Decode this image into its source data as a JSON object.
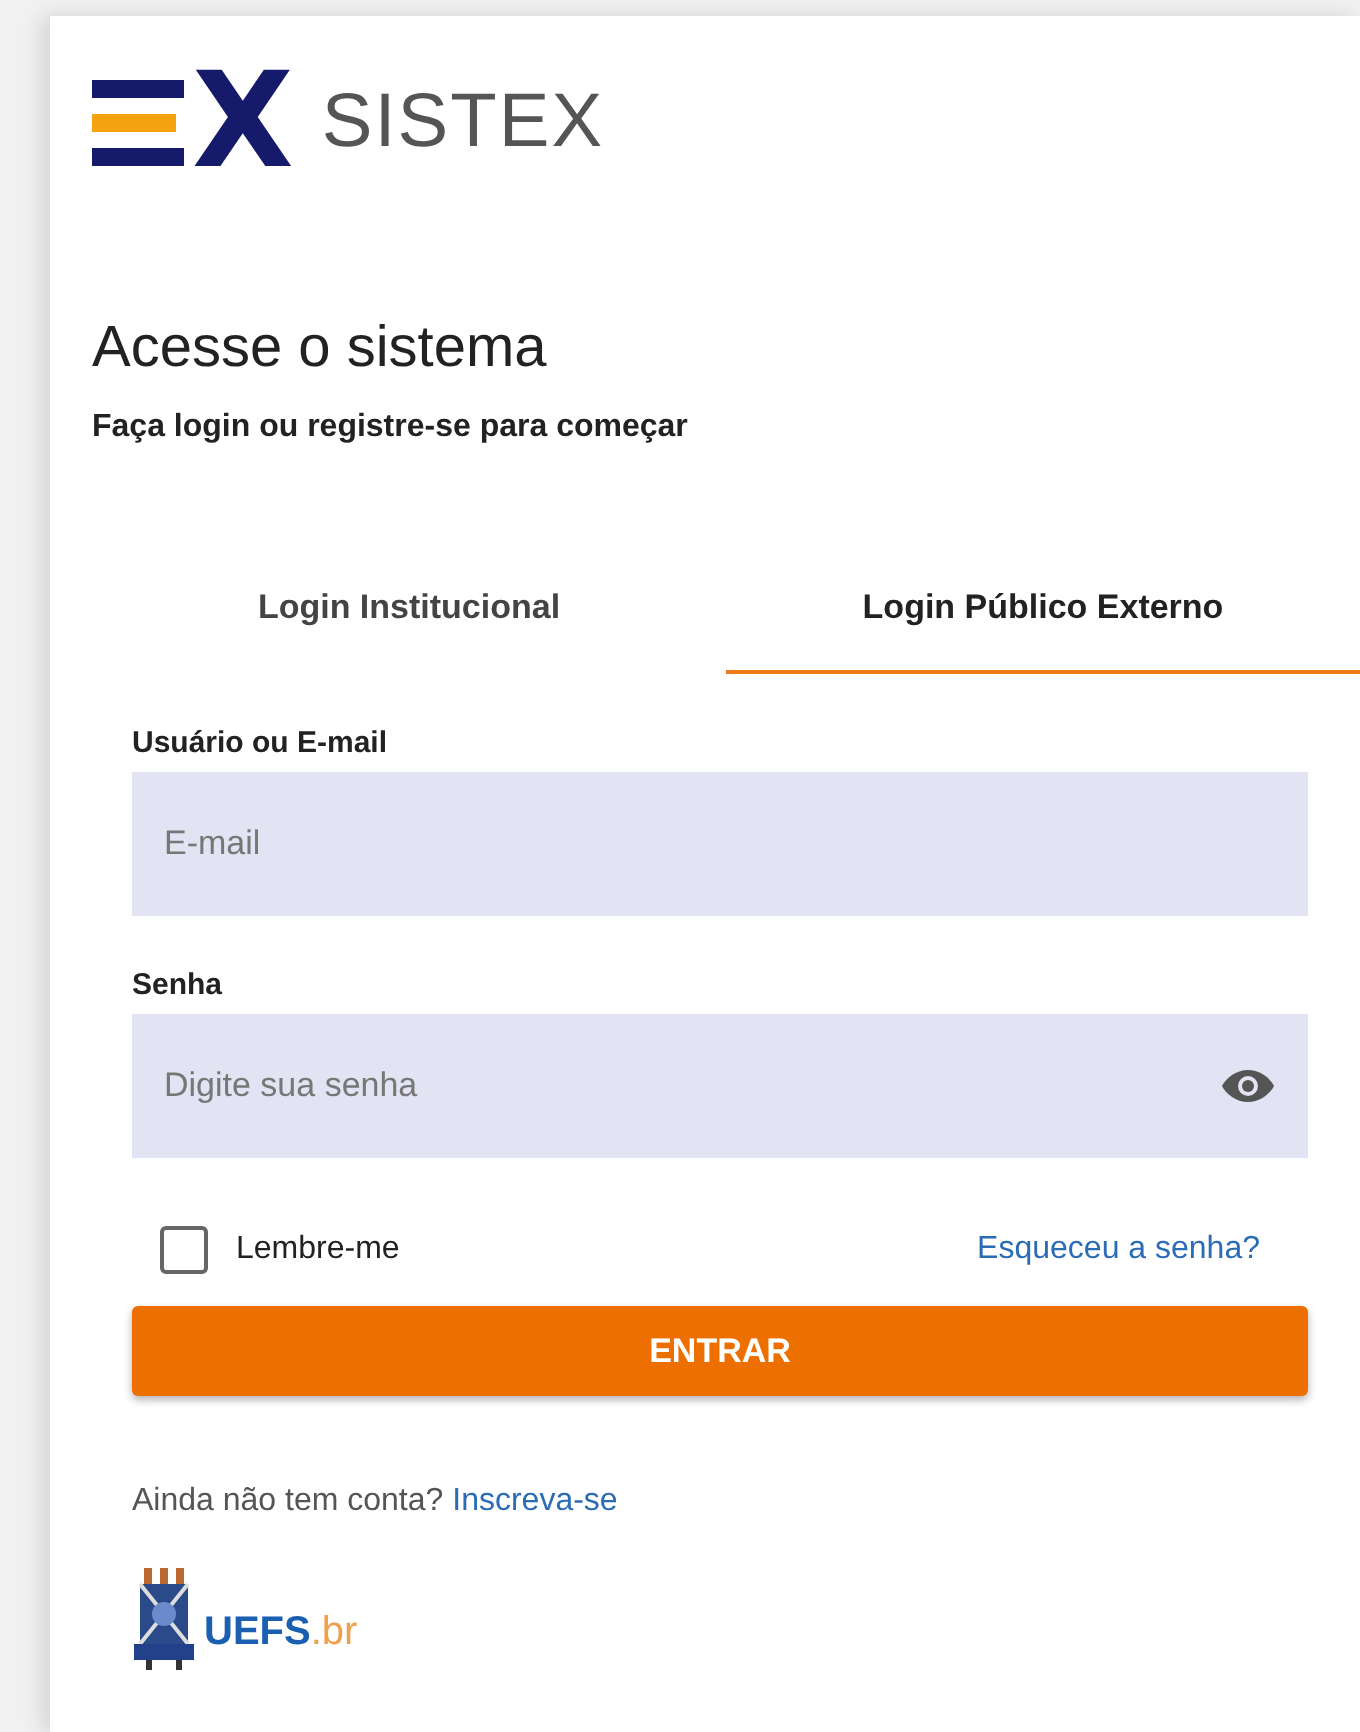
{
  "brand": {
    "mark": "X",
    "name": "SISTEX"
  },
  "heading": "Acesse o sistema",
  "subheading": "Faça login ou registre-se para começar",
  "tabs": [
    {
      "label": "Login Institucional",
      "selected": false
    },
    {
      "label": "Login Público Externo",
      "selected": true
    }
  ],
  "fields": [
    {
      "label": "Usuário ou E-mail",
      "placeholder": "E-mail",
      "kind": "text"
    },
    {
      "label": "Senha",
      "placeholder": "Digite sua senha",
      "kind": "password"
    }
  ],
  "remember": {
    "label": "Lembre-me",
    "checked": false
  },
  "forgot_link": "Esqueceu a senha?",
  "submit_button": "ENTRAR",
  "signup": {
    "text": "Ainda não tem conta?",
    "link": "Inscreva-se"
  },
  "footer_logo": {
    "name": "UEFS",
    "suffix": ".br"
  }
}
